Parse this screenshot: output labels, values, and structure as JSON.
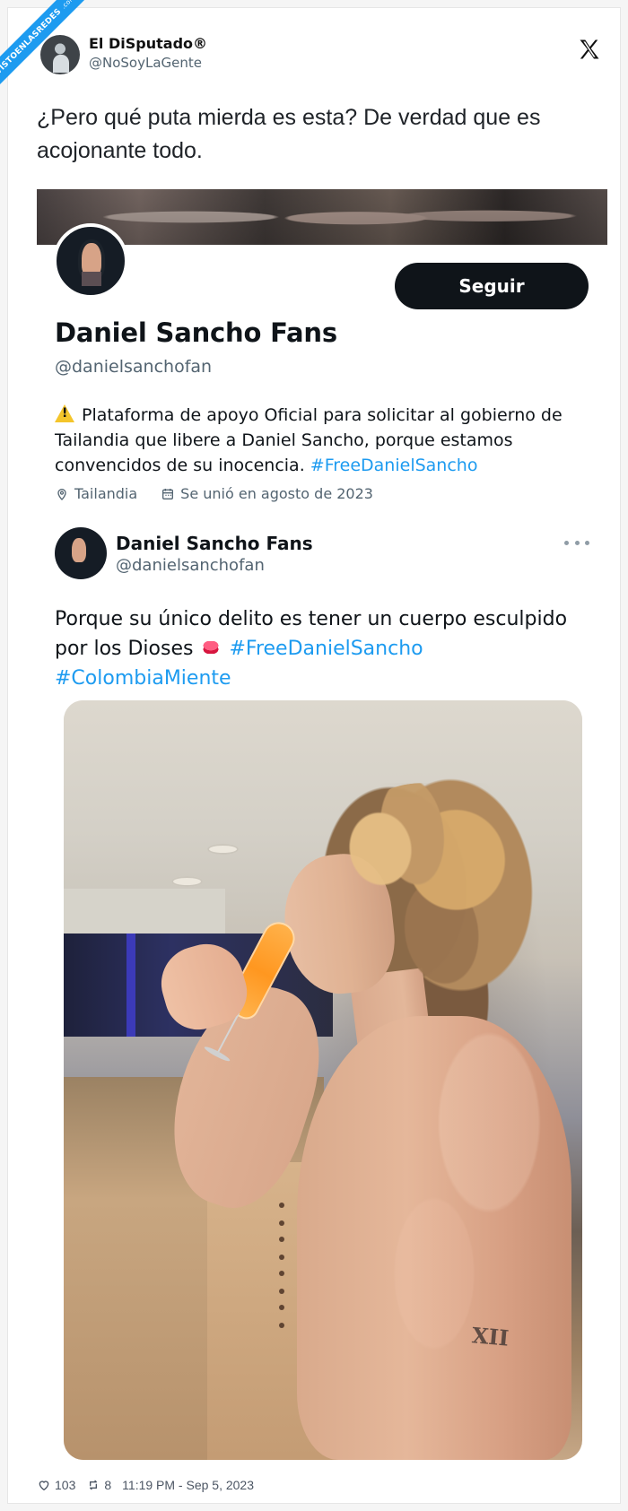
{
  "watermark": {
    "text": "VISTOENLASREDES",
    "suffix": ".com",
    "color": "#1d9bf0"
  },
  "tweet": {
    "author": {
      "display_name": "El DiSputado®",
      "handle": "@NoSoyLaGente"
    },
    "brand_icon": "x-logo-icon",
    "text": "¿Pero qué puta mierda es esta? De verdad que es\nacojonante todo.",
    "stats": {
      "likes": "103",
      "retweets": "8",
      "timestamp": "11:19 PM - Sep 5, 2023"
    }
  },
  "embedded_profile": {
    "follow_label": "Seguir",
    "name": "Daniel Sancho Fans",
    "handle": "@danielsanchofan",
    "bio": {
      "emoji": "⚠️",
      "text": "Plataforma de apoyo Oficial para solicitar al gobierno de Tailandia que libere a Daniel Sancho, porque estamos convencidos de su inocencia.",
      "hashtag": "#FreeDanielSancho"
    },
    "meta": {
      "location": "Tailandia",
      "joined": "Se unió en agosto de 2023"
    },
    "post": {
      "name": "Daniel Sancho Fans",
      "handle": "@danielsanchofan",
      "text_start": "Porque su único delito es tener un cuerpo esculpido por los Dioses",
      "emoji": "👄",
      "hashtag_1": "#FreeDanielSancho",
      "hashtag_2": "#ColombiaMiente",
      "image_tattoo": "XII"
    }
  },
  "colors": {
    "accent": "#1d9bf0",
    "text": "#0f1419",
    "secondary_text": "#536471",
    "button_bg": "#0f1419"
  }
}
